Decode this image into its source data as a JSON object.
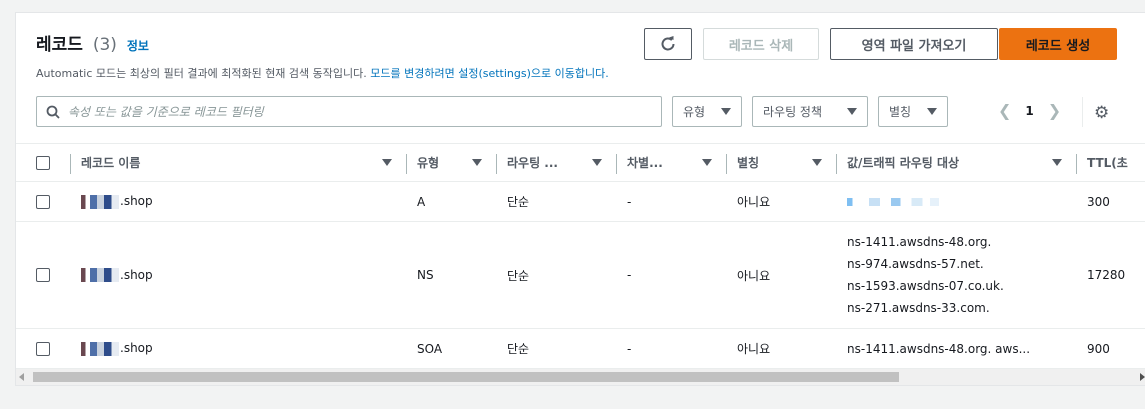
{
  "header": {
    "title": "레코드",
    "count": "(3)",
    "info_link": "정보",
    "description": "Automatic 모드는 최상의 필터 결과에 최적화된 현재 검색 동작입니다.",
    "description_link": "모드를 변경하려면 설정(settings)으로 이동합니다."
  },
  "actions": {
    "delete_label": "레코드 삭제",
    "import_label": "영역 파일 가져오기",
    "create_label": "레코드 생성",
    "refresh_icon": "refresh-icon"
  },
  "filters": {
    "search_placeholder": "속성 또는 값을 기준으로 레코드 필터링",
    "type_label": "유형",
    "routing_label": "라우팅 정책",
    "alias_label": "별칭"
  },
  "pagination": {
    "page": "1"
  },
  "table": {
    "columns": [
      "레코드 이름",
      "유형",
      "라우팅 ...",
      "차별...",
      "별칭",
      "값/트래픽 라우팅 대상",
      "TTL(초"
    ],
    "rows": [
      {
        "name": ".shop",
        "type": "A",
        "routing": "단순",
        "diff": "-",
        "alias": "아니요",
        "values": [],
        "ttl": "300"
      },
      {
        "name": ".shop",
        "type": "NS",
        "routing": "단순",
        "diff": "-",
        "alias": "아니요",
        "values": [
          "ns-1411.awsdns-48.org.",
          "ns-974.awsdns-57.net.",
          "ns-1593.awsdns-07.co.uk.",
          "ns-271.awsdns-33.com."
        ],
        "ttl": "17280"
      },
      {
        "name": ".shop",
        "type": "SOA",
        "routing": "단순",
        "diff": "-",
        "alias": "아니요",
        "values": [
          "ns-1411.awsdns-48.org. aws..."
        ],
        "ttl": "900"
      }
    ]
  },
  "colors": {
    "accent": "#ec7211",
    "link": "#0073bb"
  }
}
